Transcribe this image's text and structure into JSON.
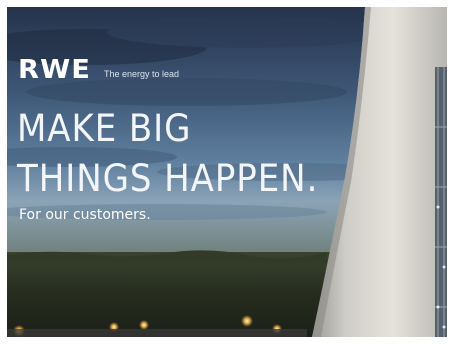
{
  "ad": {
    "brand": "RWE",
    "tagline": "The energy to lead",
    "headline_line1": "MAKE BIG",
    "headline_line2": "THINGS HAPPEN.",
    "subline": "For our customers."
  },
  "colors": {
    "sky_top": "#2a3a55",
    "sky_mid": "#4d6a8c",
    "forest": "#2c3424",
    "tower": "#d7d4cd",
    "text": "#ffffff"
  }
}
